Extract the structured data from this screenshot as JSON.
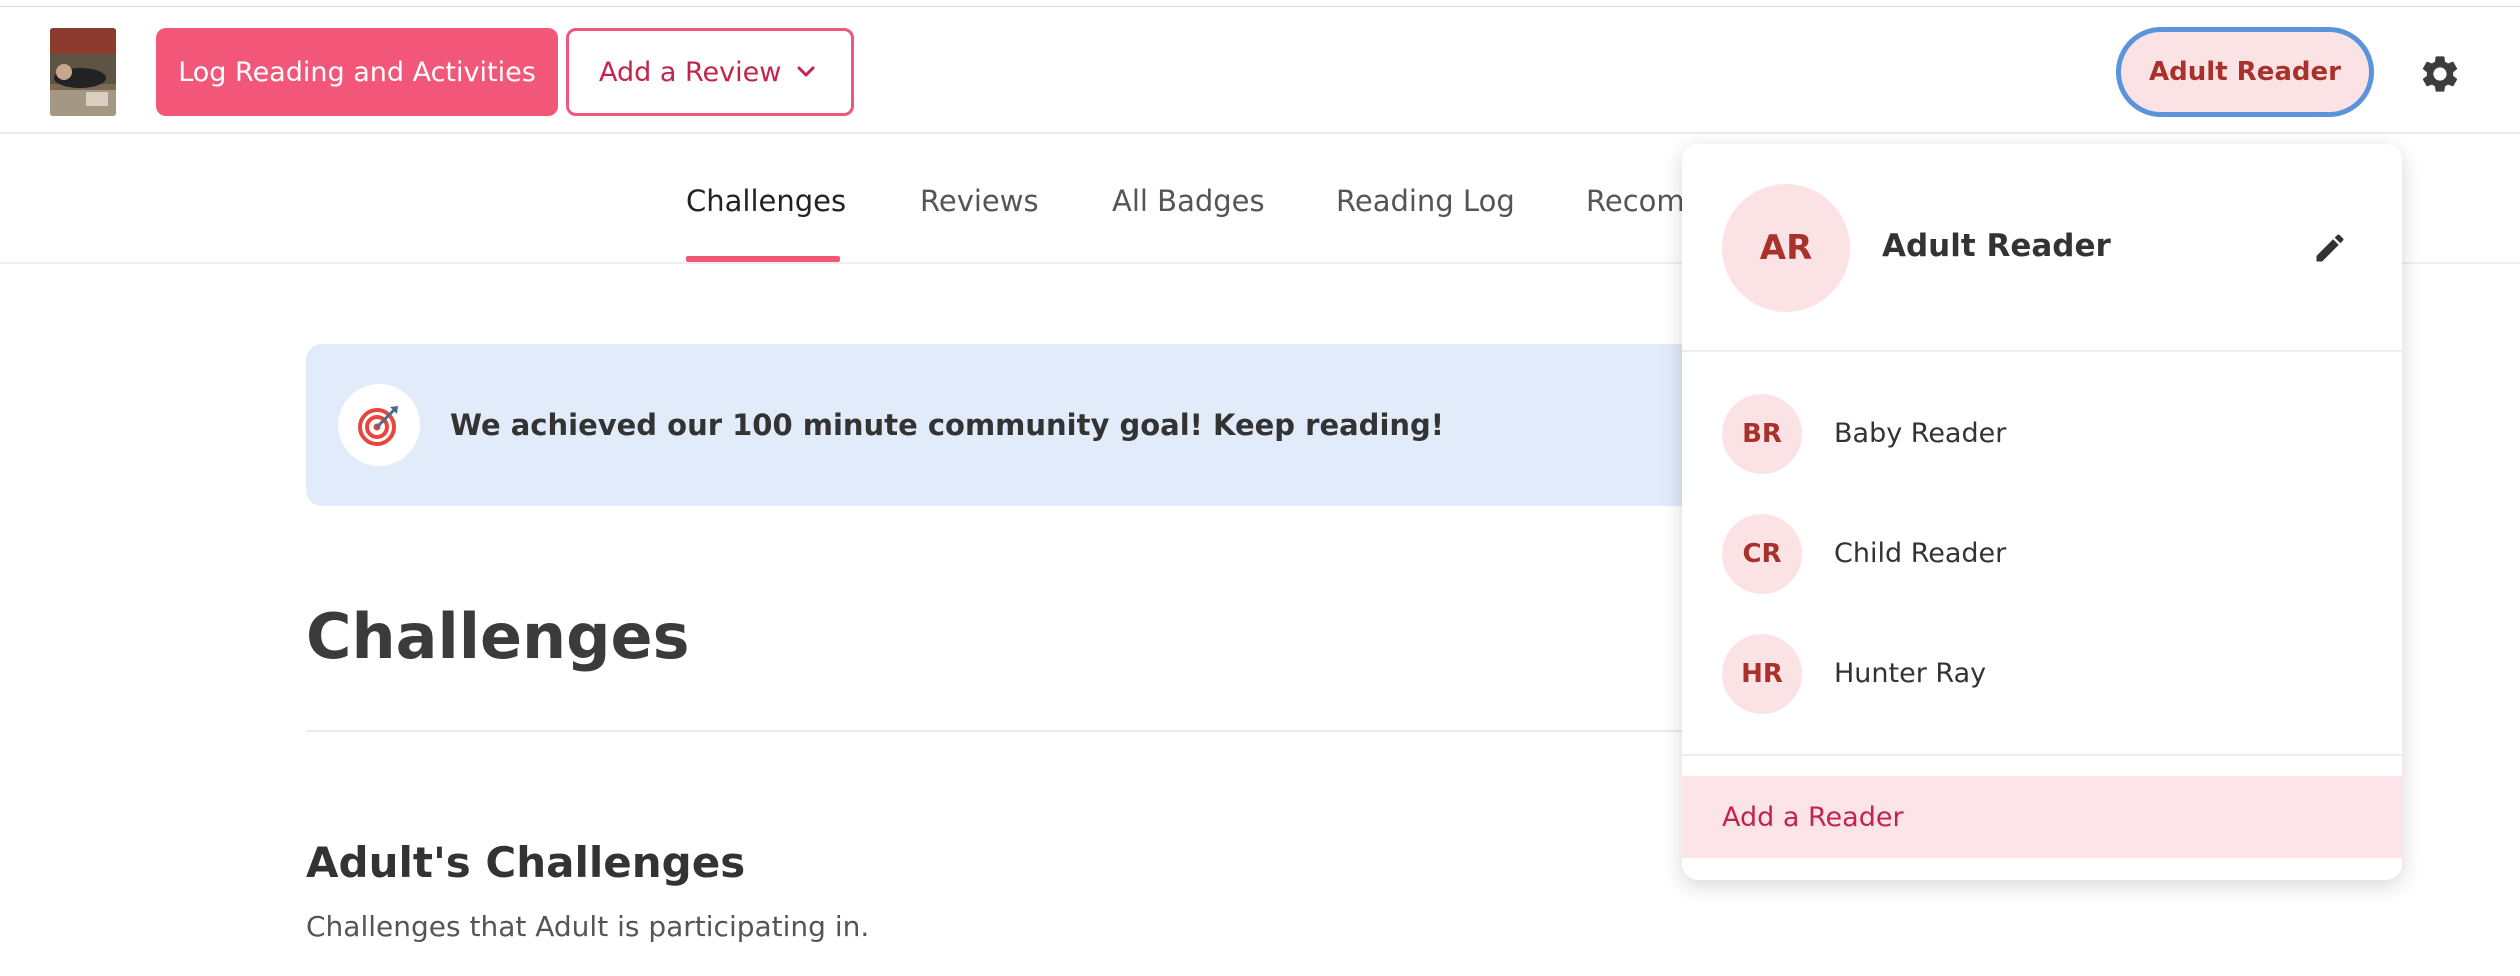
{
  "header": {
    "log_button": "Log Reading and Activities",
    "review_button": "Add a Review",
    "reader_button": "Adult Reader"
  },
  "tabs": [
    {
      "label": "Challenges",
      "active": true
    },
    {
      "label": "Reviews",
      "active": false
    },
    {
      "label": "All Badges",
      "active": false
    },
    {
      "label": "Reading Log",
      "active": false
    },
    {
      "label": "Recom",
      "active": false
    }
  ],
  "banner": {
    "icon": "target-icon",
    "text": "We achieved our 100 minute community goal! Keep reading!"
  },
  "main": {
    "title": "Challenges",
    "section_title": "Adult's Challenges",
    "section_description": "Challenges that Adult is participating in."
  },
  "reader_menu": {
    "current": {
      "initials": "AR",
      "name": "Adult Reader"
    },
    "readers": [
      {
        "initials": "BR",
        "name": "Baby Reader"
      },
      {
        "initials": "CR",
        "name": "Child Reader"
      },
      {
        "initials": "HR",
        "name": "Hunter Ray"
      }
    ],
    "add_label": "Add a Reader"
  },
  "colors": {
    "accent": "#f2577a",
    "accent_text": "#c2244b",
    "avatar_bg": "#fbe3e5",
    "avatar_text": "#a8322b",
    "banner_bg": "#e1ebf9",
    "focus_ring": "#5a93de"
  }
}
